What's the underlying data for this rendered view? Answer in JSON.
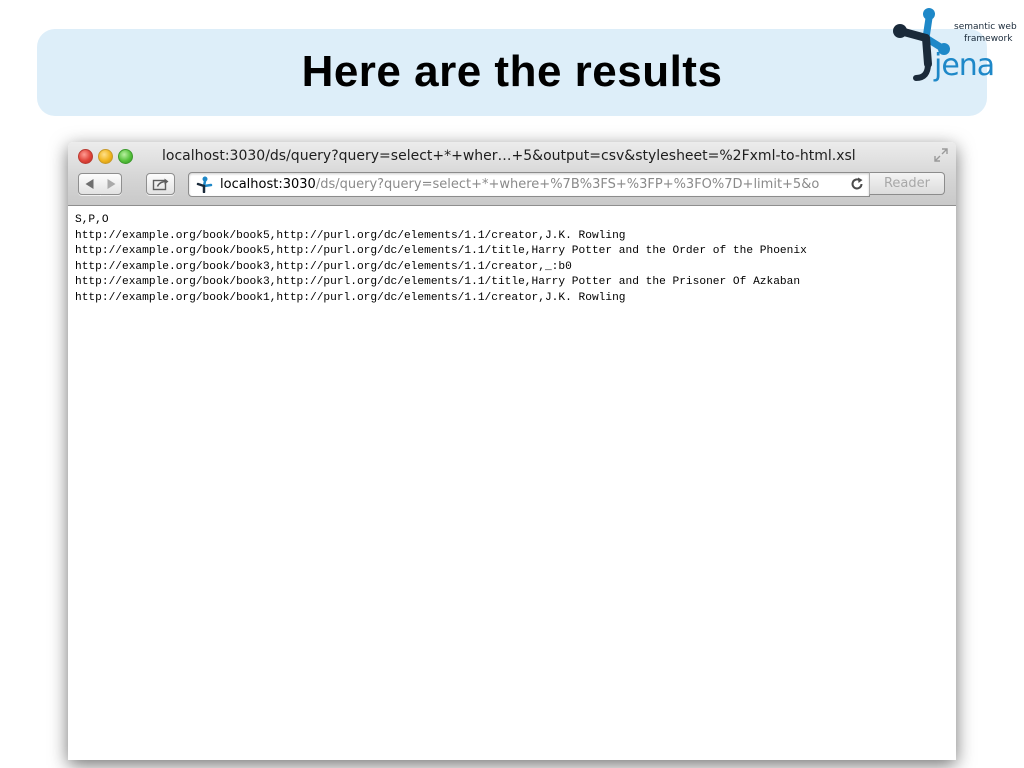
{
  "slide": {
    "title": "Here are the results",
    "logo": {
      "line1": "semantic web",
      "line2": "framework",
      "wordmark": "jena",
      "accent_color": "#1e88c8",
      "dark_color": "#1a2a3a"
    },
    "banner_color": "#ddeef9"
  },
  "browser": {
    "window_title": "localhost:3030/ds/query?query=select+*+wher…+5&output=csv&stylesheet=%2Fxml-to-html.xsl",
    "address_host": "localhost:3030",
    "address_path": "/ds/query?query=select+*+where+%7B%3FS+%3FP+%3FO%7D+limit+5&o",
    "reader_label": "Reader",
    "icons": {
      "close": "close-icon",
      "minimize": "minimize-icon",
      "zoom": "zoom-icon",
      "back": "back-arrow-icon",
      "forward": "forward-arrow-icon",
      "share": "share-icon",
      "site": "jena-favicon-icon",
      "reload": "reload-icon",
      "fullscreen": "fullscreen-icon"
    }
  },
  "content": {
    "csv_lines": [
      "S,P,O",
      "http://example.org/book/book5,http://purl.org/dc/elements/1.1/creator,J.K. Rowling",
      "http://example.org/book/book5,http://purl.org/dc/elements/1.1/title,Harry Potter and the Order of the Phoenix",
      "http://example.org/book/book3,http://purl.org/dc/elements/1.1/creator,_:b0",
      "http://example.org/book/book3,http://purl.org/dc/elements/1.1/title,Harry Potter and the Prisoner Of Azkaban",
      "http://example.org/book/book1,http://purl.org/dc/elements/1.1/creator,J.K. Rowling"
    ]
  }
}
